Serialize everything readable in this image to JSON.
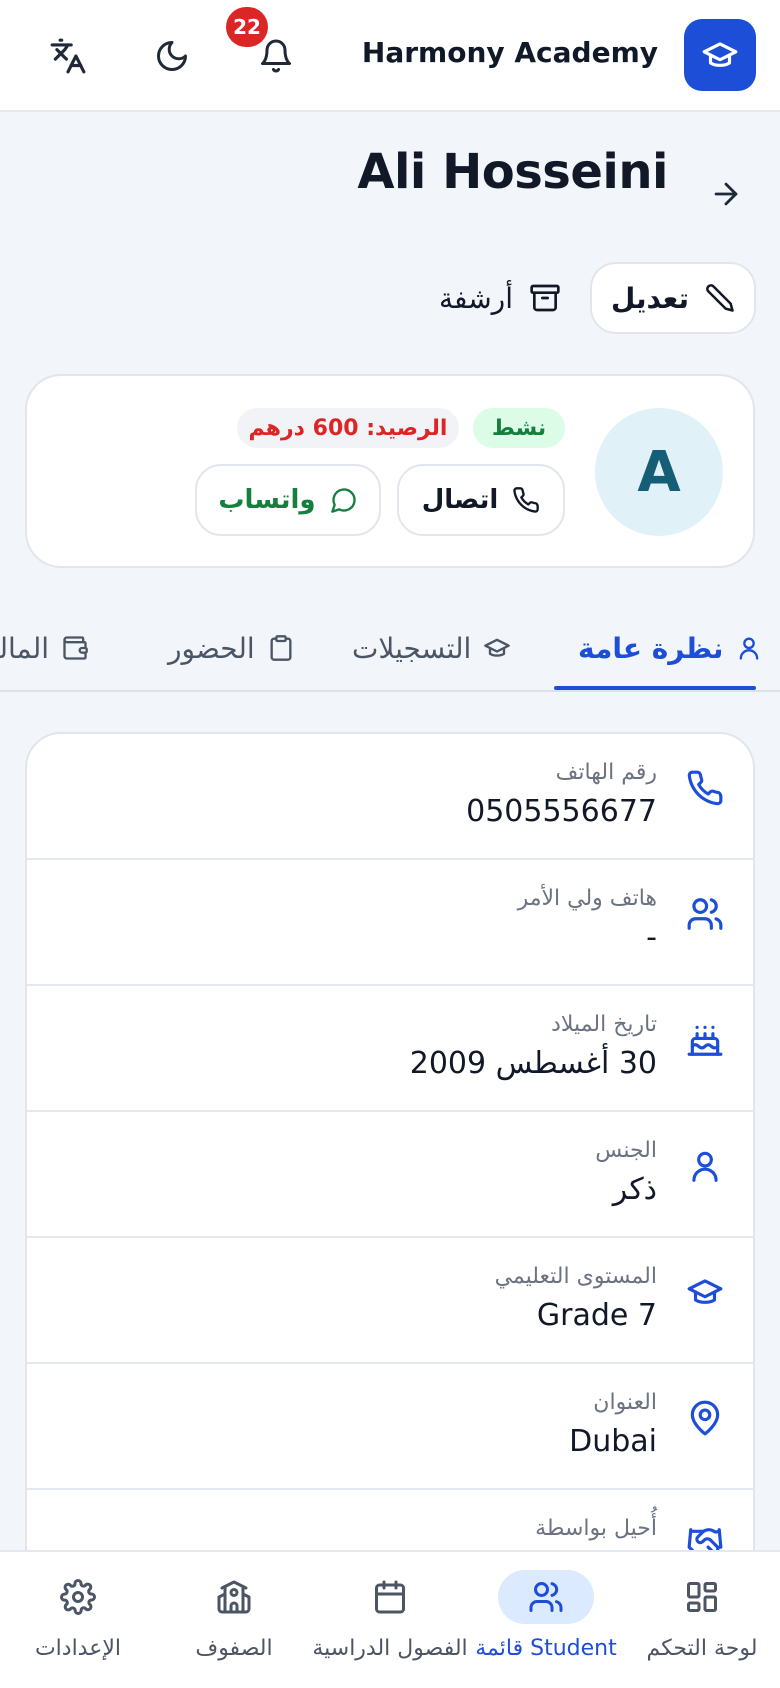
{
  "header": {
    "app_name": "Harmony Academy",
    "notifications_count": "22",
    "icons": [
      "graduation-cap-icon",
      "bell-icon",
      "moon-icon",
      "translate-icon"
    ]
  },
  "page": {
    "title": "Ali Hosseini",
    "edit_label": "تعديل",
    "archive_label": "أرشفة"
  },
  "profile": {
    "avatar_initial": "A",
    "status": "نشط",
    "balance": "الرصيد: 600 درهم",
    "call_label": "اتصال",
    "whatsapp_label": "واتساب"
  },
  "tabs": [
    {
      "label": "نظرة عامة",
      "icon": "user-icon",
      "active": true
    },
    {
      "label": "التسجيلات",
      "icon": "graduation-cap-icon",
      "active": false
    },
    {
      "label": "الحضور",
      "icon": "clipboard-icon",
      "active": false
    },
    {
      "label": "المالية",
      "icon": "wallet-icon",
      "active": false
    }
  ],
  "details": [
    {
      "label": "رقم الهاتف",
      "value": "0505556677",
      "icon": "phone-icon"
    },
    {
      "label": "هاتف ولي الأمر",
      "value": "-",
      "icon": "users-icon"
    },
    {
      "label": "تاريخ الميلاد",
      "value": "30 أغسطس 2009",
      "icon": "cake-icon"
    },
    {
      "label": "الجنس",
      "value": "ذكر",
      "icon": "user-icon"
    },
    {
      "label": "المستوى التعليمي",
      "value": "Grade 7",
      "icon": "graduation-cap-icon"
    },
    {
      "label": "العنوان",
      "value": "Dubai",
      "icon": "map-pin-icon"
    },
    {
      "label": "أُحيل بواسطة",
      "value": "",
      "icon": "handshake-icon"
    }
  ],
  "bottom_nav": [
    {
      "label": "لوحة التحكم",
      "icon": "dashboard-icon",
      "active": false
    },
    {
      "label": "قائمة Student",
      "icon": "users-icon",
      "active": true
    },
    {
      "label": "الفصول الدراسية",
      "icon": "calendar-icon",
      "active": false
    },
    {
      "label": "الصفوف",
      "icon": "school-icon",
      "active": false
    },
    {
      "label": "الإعدادات",
      "icon": "gear-icon",
      "active": false
    }
  ],
  "colors": {
    "primary": "#1d4ed8",
    "success": "#15803d",
    "danger": "#dc2626",
    "background": "#f2f5f9"
  }
}
